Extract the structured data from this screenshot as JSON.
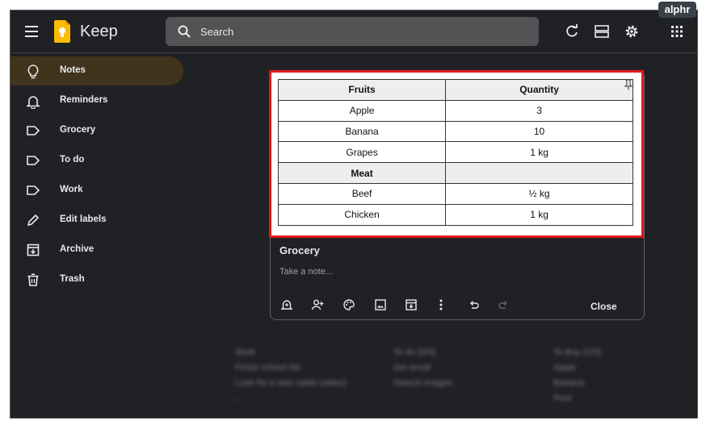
{
  "app": {
    "title": "Keep",
    "watermark": "alphr"
  },
  "header": {
    "search_placeholder": "Search"
  },
  "sidebar": {
    "items": [
      {
        "label": "Notes",
        "icon": "lightbulb-icon",
        "active": true
      },
      {
        "label": "Reminders",
        "icon": "bell-icon",
        "active": false
      },
      {
        "label": "Grocery",
        "icon": "label-icon",
        "active": false
      },
      {
        "label": "To do",
        "icon": "label-icon",
        "active": false
      },
      {
        "label": "Work",
        "icon": "label-icon",
        "active": false
      },
      {
        "label": "Edit labels",
        "icon": "pencil-icon",
        "active": false
      },
      {
        "label": "Archive",
        "icon": "archive-icon",
        "active": false
      },
      {
        "label": "Trash",
        "icon": "trash-icon",
        "active": false
      }
    ]
  },
  "note": {
    "title": "Grocery",
    "placeholder": "Take a note...",
    "close_label": "Close",
    "table": {
      "headers": [
        "Fruits",
        "Quantity"
      ],
      "rows": [
        [
          "Apple",
          "3"
        ],
        [
          "Banana",
          "10"
        ],
        [
          "Grapes",
          "1 kg"
        ],
        [
          "Meat",
          ""
        ],
        [
          "Beef",
          "½ kg"
        ],
        [
          "Chicken",
          "1 kg"
        ]
      ]
    },
    "toolbar_icons": [
      "remind-icon",
      "collaborator-icon",
      "palette-icon",
      "image-icon",
      "archive-icon",
      "more-icon",
      "undo-icon",
      "redo-icon"
    ]
  },
  "background_notes": {
    "col1": [
      "Work",
      "Finish school list",
      "Look for a new cable (video)",
      "..."
    ],
    "col2": [
      "To do (0/3)",
      "Set email",
      "Search images"
    ],
    "col3": [
      "To Buy (0/3)",
      "Apple",
      "Banana",
      "Pear"
    ]
  },
  "colors": {
    "accent": "#41331c",
    "highlight_border": "#e01a1a",
    "background": "#202124"
  }
}
